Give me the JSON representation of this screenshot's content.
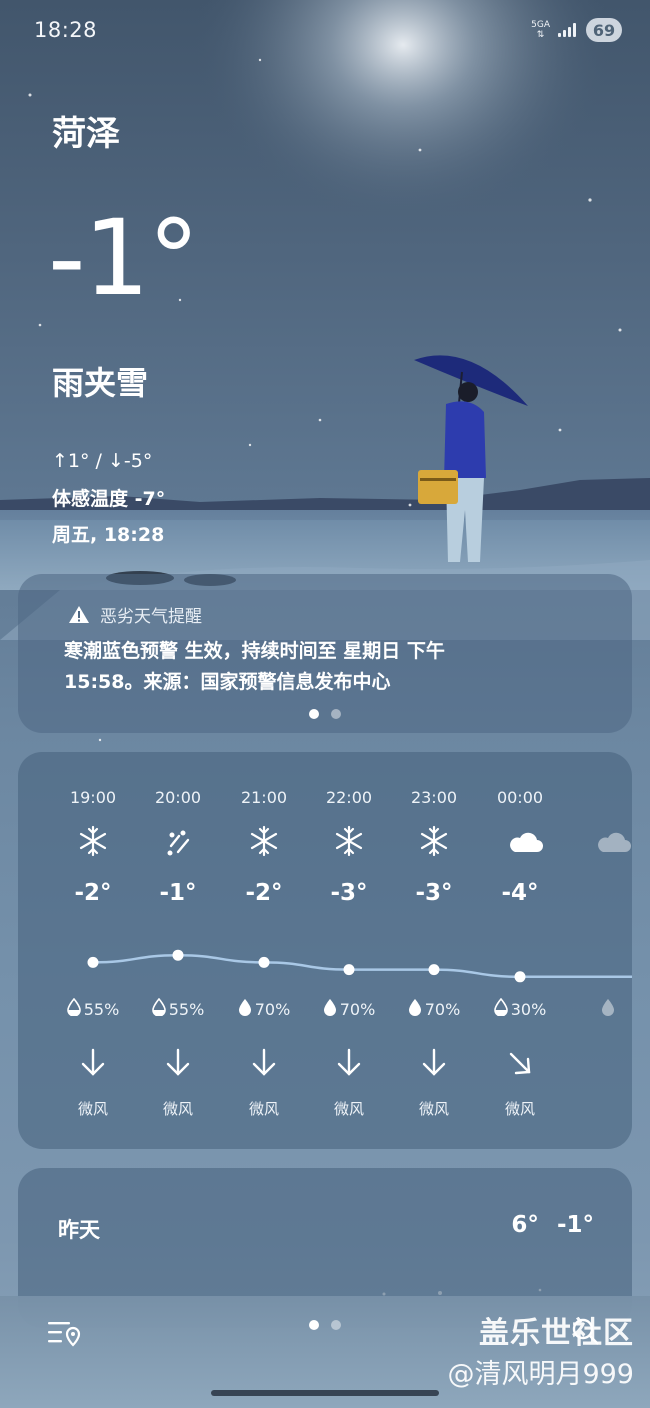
{
  "status_bar": {
    "time": "18:28",
    "network": "5GA",
    "battery": "69"
  },
  "weather": {
    "city": "菏泽",
    "temperature": "-1°",
    "condition": "雨夹雪",
    "high_low": "↑1° / ↓-5°",
    "feels_like": "体感温度 -7°",
    "datetime": "周五, 18:28"
  },
  "alert": {
    "title": "恶劣天气提醒",
    "body": "寒潮蓝色预警 生效，持续时间至 星期日 下午 15:58。来源：国家预警信息发布中心",
    "pages": 2,
    "active_page": 1
  },
  "hourly": [
    {
      "time": "19:00",
      "icon": "snowflake-icon",
      "temp": "-2°",
      "temp_value": -2,
      "precip": "55%",
      "precip_icon": "drop-half-icon",
      "wind_icon": "arrow-down-icon",
      "wind": "微风"
    },
    {
      "time": "20:00",
      "icon": "sleet-icon",
      "temp": "-1°",
      "temp_value": -1,
      "precip": "55%",
      "precip_icon": "drop-half-icon",
      "wind_icon": "arrow-down-icon",
      "wind": "微风"
    },
    {
      "time": "21:00",
      "icon": "snowflake-icon",
      "temp": "-2°",
      "temp_value": -2,
      "precip": "70%",
      "precip_icon": "drop-full-icon",
      "wind_icon": "arrow-down-icon",
      "wind": "微风"
    },
    {
      "time": "22:00",
      "icon": "snowflake-icon",
      "temp": "-3°",
      "temp_value": -3,
      "precip": "70%",
      "precip_icon": "drop-full-icon",
      "wind_icon": "arrow-down-icon",
      "wind": "微风"
    },
    {
      "time": "23:00",
      "icon": "snowflake-icon",
      "temp": "-3°",
      "temp_value": -3,
      "precip": "70%",
      "precip_icon": "drop-full-icon",
      "wind_icon": "arrow-down-icon",
      "wind": "微风"
    },
    {
      "time": "00:00",
      "icon": "cloud-icon",
      "temp": "-4°",
      "temp_value": -4,
      "precip": "30%",
      "precip_icon": "drop-half-icon",
      "wind_icon": "arrow-down-right-icon",
      "wind": "微风"
    }
  ],
  "daily": [
    {
      "day": "昨天",
      "high": "6°",
      "low": "-1°"
    }
  ],
  "bottom_bar": {
    "pages": 2,
    "active_page": 1
  },
  "watermark": {
    "line1": "盖乐世社区",
    "line2": "@清风明月999"
  }
}
